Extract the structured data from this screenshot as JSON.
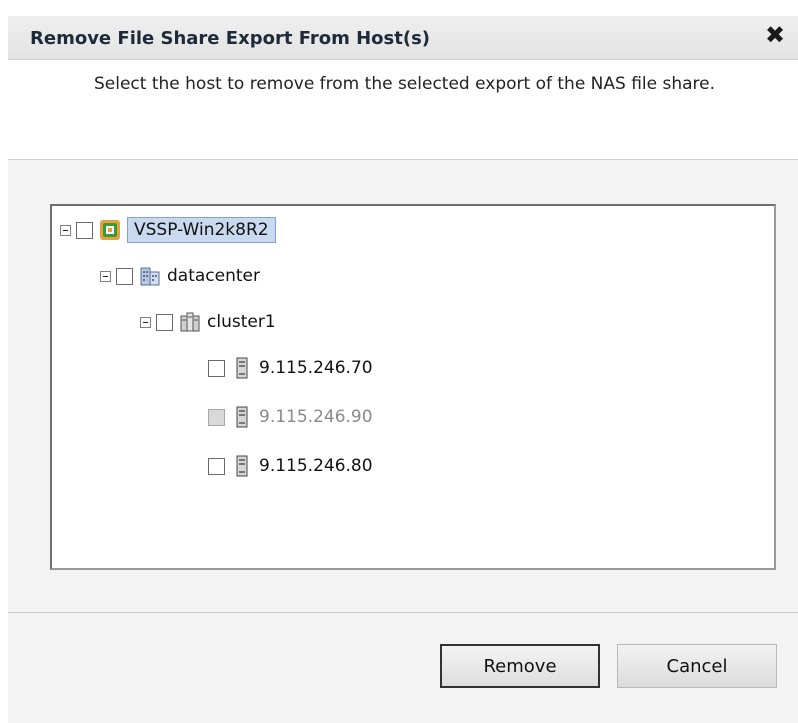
{
  "dialog": {
    "title": "Remove File Share Export From Host(s)",
    "close_icon": "close-icon",
    "instruction": "Select the host to remove from the selected export of the NAS file share."
  },
  "tree": {
    "root": {
      "label": "VSSP-Win2k8R2",
      "icon": "vcenter-icon",
      "checked": false,
      "expanded": true,
      "selected": true
    },
    "datacenter": {
      "label": "datacenter",
      "icon": "datacenter-icon",
      "checked": false,
      "expanded": true
    },
    "cluster": {
      "label": "cluster1",
      "icon": "cluster-icon",
      "checked": false,
      "expanded": true
    },
    "hosts": [
      {
        "label": "9.115.246.70",
        "icon": "host-server-icon",
        "checked": false,
        "enabled": true
      },
      {
        "label": "9.115.246.90",
        "icon": "host-server-icon",
        "checked": false,
        "enabled": false
      },
      {
        "label": "9.115.246.80",
        "icon": "host-server-icon",
        "checked": false,
        "enabled": true
      }
    ]
  },
  "buttons": {
    "remove_label": "Remove",
    "cancel_label": "Cancel"
  },
  "colors": {
    "selection_bg": "#c9daf0",
    "selection_border": "#7fa4d3",
    "vcenter_orange": "#e8a13a",
    "vcenter_green": "#3a9a3a"
  }
}
